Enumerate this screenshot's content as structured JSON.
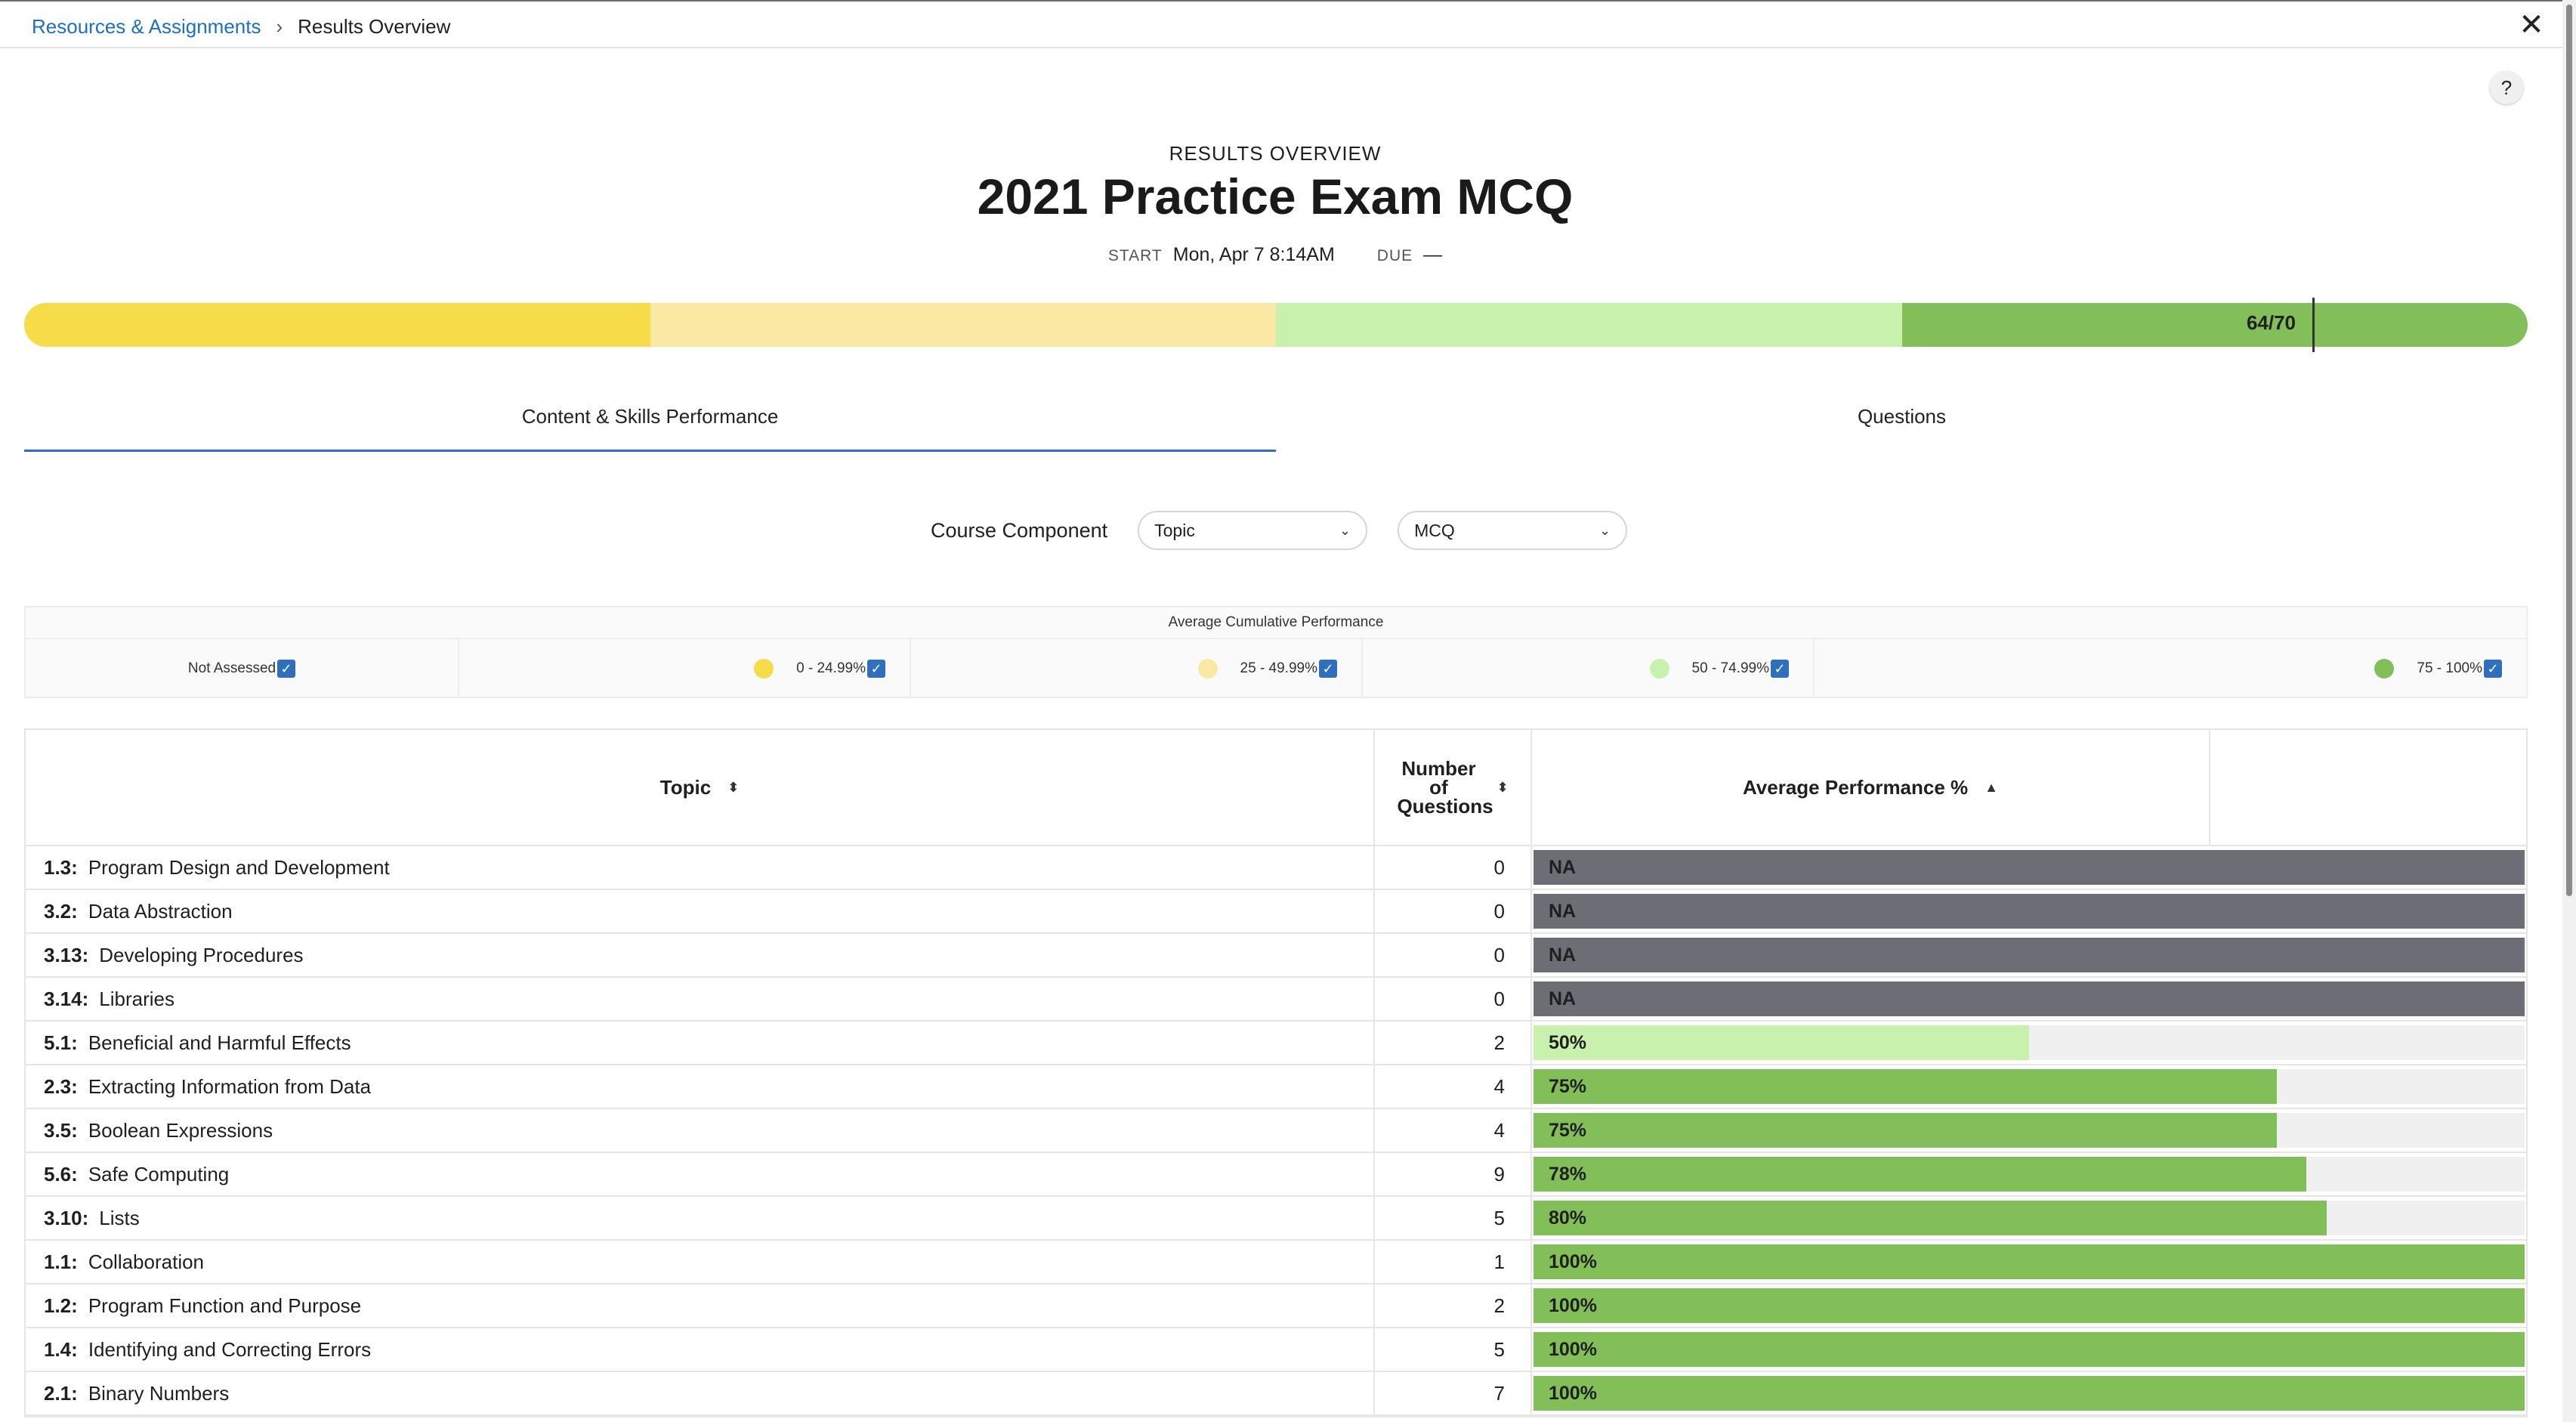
{
  "breadcrumb": {
    "parent": "Resources & Assignments",
    "separator": "›",
    "current": "Results Overview"
  },
  "close_glyph": "✕",
  "help_glyph": "?",
  "header": {
    "eyebrow": "RESULTS OVERVIEW",
    "title": "2021 Practice Exam MCQ",
    "start_label": "START",
    "start_value": "Mon, Apr 7 8:14AM",
    "due_label": "DUE",
    "due_value": "—"
  },
  "score": {
    "text": "64/70",
    "value": 64,
    "max": 70
  },
  "score_band_colors": [
    "#f7dc4a",
    "#fbe9a3",
    "#c8f1ae",
    "#82bf59"
  ],
  "tabs": [
    {
      "label": "Content & Skills Performance",
      "active": true
    },
    {
      "label": "Questions",
      "active": false
    }
  ],
  "filters": {
    "label": "Course Component",
    "component_select": "Topic",
    "type_select": "MCQ"
  },
  "legend": {
    "title": "Average Cumulative Performance",
    "items": [
      {
        "label": "Not Assessed",
        "color": ""
      },
      {
        "label": "0 - 24.99%",
        "color": "#f7dc4a"
      },
      {
        "label": "25 - 49.99%",
        "color": "#fbe9a3"
      },
      {
        "label": "50 - 74.99%",
        "color": "#c8f1ae"
      },
      {
        "label": "75 - 100%",
        "color": "#82bf59"
      }
    ]
  },
  "table": {
    "headers": {
      "topic": "Topic",
      "num_questions": "Number of Questions",
      "avg_perf": "Average Performance %"
    },
    "rows": [
      {
        "code": "1.3:",
        "topic": "Program Design and Development",
        "num": "0",
        "pct": null,
        "label": "NA"
      },
      {
        "code": "3.2:",
        "topic": "Data Abstraction",
        "num": "0",
        "pct": null,
        "label": "NA"
      },
      {
        "code": "3.13:",
        "topic": "Developing Procedures",
        "num": "0",
        "pct": null,
        "label": "NA"
      },
      {
        "code": "3.14:",
        "topic": "Libraries",
        "num": "0",
        "pct": null,
        "label": "NA"
      },
      {
        "code": "5.1:",
        "topic": "Beneficial and Harmful Effects",
        "num": "2",
        "pct": 50,
        "label": "50%"
      },
      {
        "code": "2.3:",
        "topic": "Extracting Information from Data",
        "num": "4",
        "pct": 75,
        "label": "75%"
      },
      {
        "code": "3.5:",
        "topic": "Boolean Expressions",
        "num": "4",
        "pct": 75,
        "label": "75%"
      },
      {
        "code": "5.6:",
        "topic": "Safe Computing",
        "num": "9",
        "pct": 78,
        "label": "78%"
      },
      {
        "code": "3.10:",
        "topic": "Lists",
        "num": "5",
        "pct": 80,
        "label": "80%"
      },
      {
        "code": "1.1:",
        "topic": "Collaboration",
        "num": "1",
        "pct": 100,
        "label": "100%"
      },
      {
        "code": "1.2:",
        "topic": "Program Function and Purpose",
        "num": "2",
        "pct": 100,
        "label": "100%"
      },
      {
        "code": "1.4:",
        "topic": "Identifying and Correcting Errors",
        "num": "5",
        "pct": 100,
        "label": "100%"
      },
      {
        "code": "2.1:",
        "topic": "Binary Numbers",
        "num": "7",
        "pct": 100,
        "label": "100%"
      }
    ]
  },
  "colors": {
    "na_bar": "#6d6d75",
    "link": "#1e6fbf",
    "accent": "#2f6fbe"
  }
}
